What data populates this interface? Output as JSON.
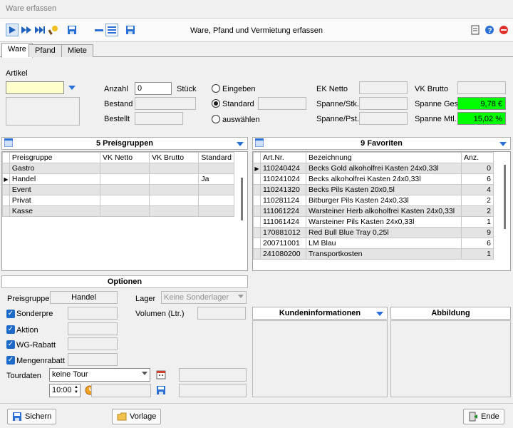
{
  "window": {
    "title": "Ware erfassen"
  },
  "toolbar": {
    "center_title": "Ware, Pfand und Vermietung erfassen"
  },
  "tabs": [
    "Ware",
    "Pfand",
    "Miete"
  ],
  "artikel": {
    "label": "Artikel",
    "value": ""
  },
  "fields": {
    "anzahl_label": "Anzahl",
    "anzahl_value": "0",
    "anzahl_unit": "Stück",
    "bestand_label": "Bestand",
    "bestellt_label": "Bestellt",
    "ek_netto_label": "EK Netto",
    "spanne_stk_label": "Spanne/Stk.",
    "spanne_pst_label": "Spanne/Pst.",
    "vk_brutto_label": "VK Brutto",
    "spanne_ges_label": "Spanne Ges.",
    "spanne_ges_value": "9,78 €",
    "spanne_mtl_label": "Spanne Mtl.",
    "spanne_mtl_value": "15,02 %"
  },
  "radios": {
    "eingeben": "Eingeben",
    "standard": "Standard",
    "auswaehlen": "auswählen"
  },
  "preisgruppen": {
    "title": "5 Preisgruppen",
    "columns": [
      "Preisgruppe",
      "VK Netto",
      "VK Brutto",
      "Standard"
    ],
    "rows": [
      {
        "name": "Gastro",
        "netto": "",
        "brutto": "",
        "standard": ""
      },
      {
        "name": "Handel",
        "netto": "",
        "brutto": "",
        "standard": "Ja"
      },
      {
        "name": "Event",
        "netto": "",
        "brutto": "",
        "standard": ""
      },
      {
        "name": "Privat",
        "netto": "",
        "brutto": "",
        "standard": ""
      },
      {
        "name": "Kasse",
        "netto": "",
        "brutto": "",
        "standard": ""
      }
    ]
  },
  "favoriten": {
    "title": "9 Favoriten",
    "columns": [
      "Art.Nr.",
      "Bezeichnung",
      "Anz."
    ],
    "rows": [
      {
        "nr": "110240424",
        "bez": "Becks Gold alkoholfrei Kasten 24x0,33l",
        "anz": "0"
      },
      {
        "nr": "110241024",
        "bez": "Becks alkoholfrei Kasten 24x0,33l",
        "anz": "6"
      },
      {
        "nr": "110241320",
        "bez": "Becks Pils Kasten 20x0,5l",
        "anz": "4"
      },
      {
        "nr": "110281124",
        "bez": "Bitburger Pils Kasten 24x0,33l",
        "anz": "2"
      },
      {
        "nr": "111061224",
        "bez": "Warsteiner Herb alkoholfrei Kasten 24x0,33l",
        "anz": "2"
      },
      {
        "nr": "111061424",
        "bez": "Warsteiner Pils Kasten 24x0,33l",
        "anz": "1"
      },
      {
        "nr": "170881012",
        "bez": "Red Bull Blue Tray 0,25l",
        "anz": "9"
      },
      {
        "nr": "200711001",
        "bez": "LM Blau",
        "anz": "6"
      },
      {
        "nr": "241080200",
        "bez": "Transportkosten",
        "anz": "1"
      }
    ]
  },
  "optionen": {
    "title": "Optionen",
    "preisgruppe_label": "Preisgruppe",
    "preisgruppe_value": "Handel",
    "lager_label": "Lager",
    "lager_value": "Keine Sonderlager",
    "volumen_label": "Volumen (Ltr.)",
    "sonderpreis": "Sonderpre",
    "aktion": "Aktion",
    "wg_rabatt": "WG-Rabatt",
    "mengenrabatt": "Mengenrabatt",
    "tourdaten_label": "Tourdaten",
    "tour_value": "keine Tour",
    "time_value": "10:00"
  },
  "kunden": {
    "title": "Kundeninformationen"
  },
  "abbildung": {
    "title": "Abbildung"
  },
  "buttons": {
    "sichern": "Sichern",
    "vorlage": "Vorlage",
    "ende": "Ende"
  },
  "colors": {
    "accent": "#2a6fd6",
    "highlight": "#00ff00"
  }
}
